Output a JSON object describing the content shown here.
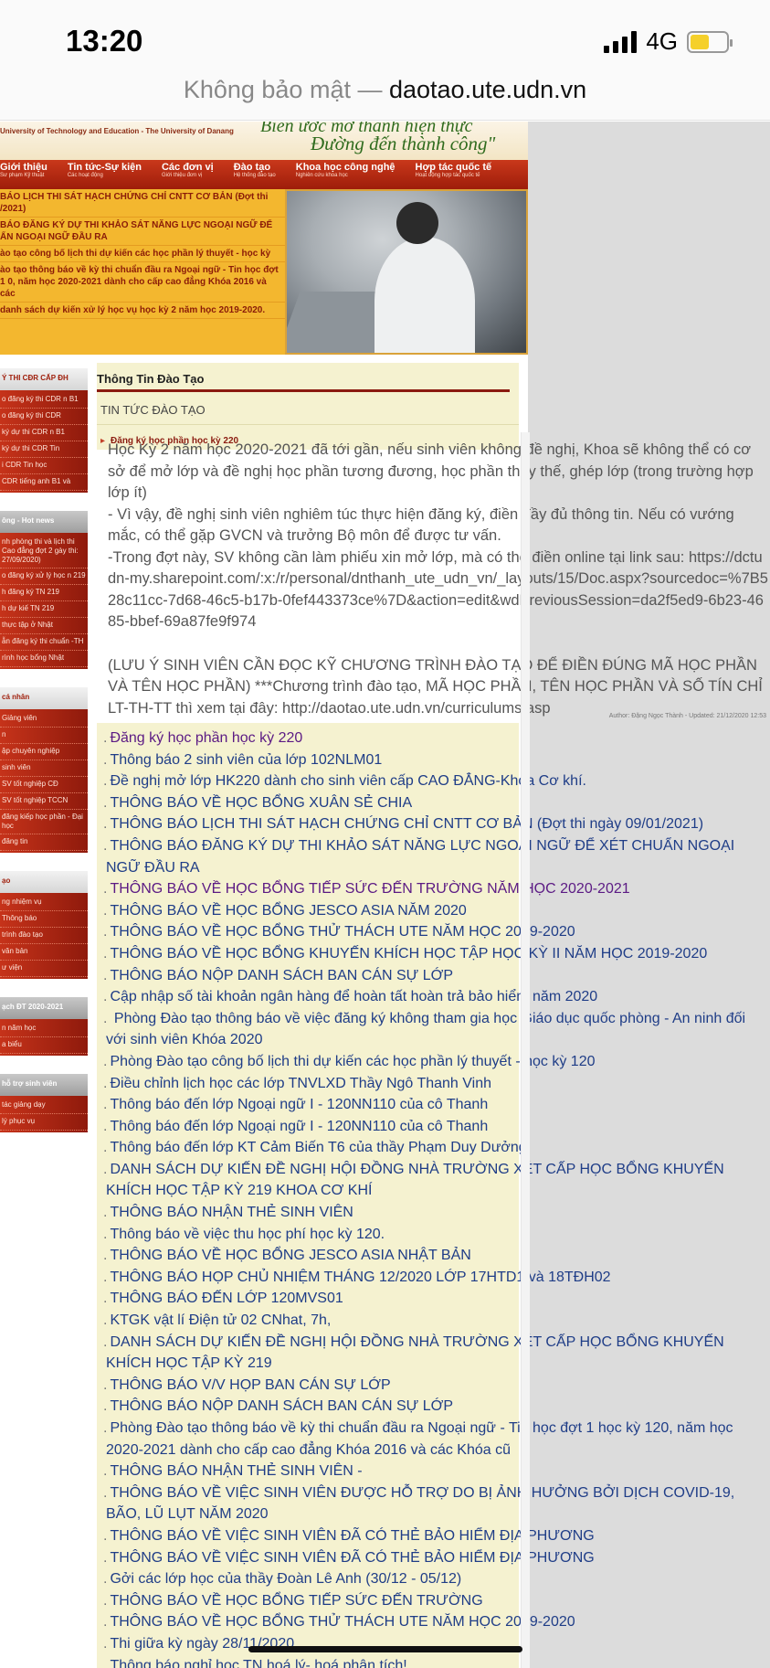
{
  "status_bar": {
    "time": "13:20",
    "network": "4G",
    "battery_level": 0.4,
    "signal_bars": 4
  },
  "url_bar": {
    "insecure_label": "Không bảo mật —",
    "domain": "daotao.ute.udn.vn"
  },
  "banner": {
    "university_name": "University of Technology and Education - The University of Danang",
    "motto_line1": "Biến ước mơ thành hiện thực",
    "motto_line2": "Đường đến thành công\"",
    "nav": [
      {
        "label": "Giới thiệu",
        "sub": "Sư phạm Kỹ thuật"
      },
      {
        "label": "Tin tức-Sự kiện",
        "sub": "Các hoạt động"
      },
      {
        "label": "Các đơn vị",
        "sub": "Giới thiệu đơn vị"
      },
      {
        "label": "Đào tạo",
        "sub": "Hệ thống đào tạo"
      },
      {
        "label": "Khoa học công nghệ",
        "sub": "Nghiên cứu khoa học"
      },
      {
        "label": "Hợp tác quốc tế",
        "sub": "Hoạt động hợp tác quốc tế"
      }
    ],
    "news": [
      "BÁO LỊCH THI SÁT HẠCH CHỨNG CHỈ CNTT CƠ BẢN (Đợt thi /2021)",
      "BÁO ĐĂNG KÝ DỰ THI KHẢO SÁT NĂNG LỰC NGOẠI NGỮ ĐỂ ẨN NGOẠI NGỮ ĐẦU RA",
      "ào tạo công bố lịch thi dự kiến các học phần lý thuyết - học kỳ",
      "ào tạo thông báo về kỳ thi chuẩn đầu ra Ngoại ngữ - Tin học đợt 1 0, năm học 2020-2021 dành cho cấp cao đẳng Khóa 2016 và các",
      "danh sách dự kiến xử lý học vụ học kỳ 2 năm học 2019-2020."
    ]
  },
  "sidebar": {
    "boxes": [
      {
        "title": "Ý THI CĐR CẤP ĐH",
        "dark": false,
        "items": [
          "o đăng ký thi CDR n B1",
          "o đăng ký thi CDR",
          "ký dự thi CDR n B1",
          "ký dự thi CDR Tin",
          "i CDR Tin học",
          "CDR tiếng anh B1 và"
        ]
      },
      {
        "title": "ông - Hot news",
        "dark": true,
        "items": [
          "nh phòng thi và lịch thi Cao đẳng đợt 2 gày thi: 27/09/2020)",
          "o đăng ký xử lý học n 219",
          "h đăng ký TN 219",
          "h dự kiế TN 219",
          "thực tập ở Nhật",
          "ẫn đăng ký thi chuẩn -TH",
          "rình học bổng Nhật"
        ]
      },
      {
        "title": "cá nhân",
        "dark": false,
        "items": [
          "Giảng viên",
          "n",
          "ập chuyên nghiệp",
          "sinh viên",
          "SV tốt nghiệp CĐ",
          "SV tốt nghiệp TCCN",
          "đăng kiếp học phần - Đại học",
          "đăng tin"
        ]
      },
      {
        "title": "ạo",
        "dark": false,
        "items": [
          "ng nhiệm vụ",
          "Thông báo",
          "trình đào tạo",
          "văn bản",
          "ư viện"
        ]
      },
      {
        "title": "ạch ĐT 2020-2021",
        "dark": true,
        "items": [
          "n năm học",
          "a biểu"
        ]
      },
      {
        "title": "hỗ trợ sinh viên",
        "dark": true,
        "items": [
          "tác giảng dạy",
          "lý phục vụ"
        ]
      }
    ]
  },
  "content": {
    "section_title": "Thông Tin Đào Tạo",
    "subhead": "TIN TỨC ĐÀO TẠO",
    "article_title": "Đăng ký học phần học kỳ 220",
    "article_paragraphs": [
      "Học Kỳ 2 năm học 2020-2021 đã tới gần, nếu sinh viên không đề nghị, Khoa sẽ không thể có cơ sở để mở lớp và đề nghị học phần tương đương, học phần thay thế, ghép lớp (trong trường hợp lớp ít)",
      "- Vì vậy, đề nghị sinh viên nghiêm túc thực hiện đăng ký, điền đầy đủ thông tin. Nếu có vướng mắc, có thể gặp GVCN và trưởng Bộ môn để được tư vấn.",
      "-Trong đợt này, SV không cần làm phiếu xin mở lớp, mà có thể điền online tại link sau: https://dctudn-my.sharepoint.com/:x:/r/personal/dnthanh_ute_udn_vn/_layouts/15/Doc.aspx?sourcedoc=%7B528c11cc-7d68-46c5-b17b-0fef443373ce%7D&action=edit&wdPreviousSession=da2f5ed9-6b23-4685-bbef-69a87fe9f974",
      "(LƯU Ý SINH VIÊN CẦN ĐỌC KỸ CHƯƠNG TRÌNH ĐÀO TẠO ĐỂ ĐIỀN ĐÚNG MÃ HỌC PHẦN VÀ TÊN HỌC PHẦN) ***Chương trình đào tạo, MÃ HỌC PHẦN, TÊN HỌC PHẦN VÀ SỐ TÍN CHỈ LT-TH-TT thì xem tại đây: http://daotao.ute.udn.vn/curriculums.asp"
    ],
    "author_line": "Author: Đặng Ngọc Thành - Updated: 21/12/2020 12:53",
    "news_list": [
      {
        "text": "Đăng ký học phần học kỳ 220",
        "visited": true
      },
      {
        "text": "Thông báo 2 sinh viên của lớp 102NLM01",
        "visited": false
      },
      {
        "text": "Đề nghị mở lớp HK220 dành cho sinh viên cấp CAO ĐẲNG-Khoa Cơ khí.",
        "visited": false
      },
      {
        "text": "THÔNG BÁO VỀ HỌC BỔNG XUÂN SẺ CHIA",
        "visited": false
      },
      {
        "text": "THÔNG BÁO LỊCH THI SÁT HẠCH CHỨNG CHỈ CNTT CƠ BẢN (Đợt thi ngày 09/01/2021)",
        "visited": false
      },
      {
        "text": "THÔNG BÁO ĐĂNG KÝ DỰ THI KHẢO SÁT NĂNG LỰC NGOẠI NGỮ ĐỂ XÉT CHUẨN NGOẠI NGỮ ĐẦU RA",
        "visited": false
      },
      {
        "text": "THÔNG BÁO VỀ HỌC BỔNG TIẾP SỨC ĐẾN TRƯỜNG NĂM HỌC 2020-2021",
        "visited": true
      },
      {
        "text": "THÔNG BÁO VỀ HỌC BỔNG JESCO ASIA NĂM 2020",
        "visited": false
      },
      {
        "text": "THÔNG BÁO VỀ HỌC BỔNG THỬ THÁCH UTE NĂM HỌC 2019-2020",
        "visited": false
      },
      {
        "text": "THÔNG BÁO VỀ HỌC BỔNG KHUYẾN KHÍCH HỌC TẬP HỌC KỲ II NĂM HỌC 2019-2020",
        "visited": false
      },
      {
        "text": "THÔNG BÁO NỘP DANH SÁCH BAN CÁN SỰ LỚP",
        "visited": false
      },
      {
        "text": "Cập nhập số tài khoản ngân hàng để hoàn tất hoàn trả bảo hiểm năm 2020",
        "visited": false
      },
      {
        "text": " Phòng Đào tạo thông báo về việc đăng ký không tham gia học Giáo dục quốc phòng - An ninh đối với sinh viên Khóa 2020",
        "visited": false
      },
      {
        "text": "Phòng Đào tạo công bố lịch thi dự kiến các học phần lý thuyết - học kỳ 120",
        "visited": false
      },
      {
        "text": "Điều chỉnh lịch học các lớp TNVLXD Thầy Ngô Thanh Vinh",
        "visited": false
      },
      {
        "text": "Thông báo đến lớp Ngoại ngữ I - 120NN110 của cô Thanh",
        "visited": false
      },
      {
        "text": "Thông báo đến lớp Ngoại ngữ I - 120NN110 của cô Thanh",
        "visited": false
      },
      {
        "text": "Thông báo đến lớp KT Cảm Biến T6 của thầy Phạm Duy Dưởng",
        "visited": false
      },
      {
        "text": "DANH SÁCH DỰ KIẾN ĐỀ NGHỊ HỘI ĐỒNG NHÀ TRƯỜNG XÉT CẤP HỌC BỔNG KHUYẾN KHÍCH HỌC TẬP KỲ 219 KHOA CƠ KHÍ",
        "visited": false
      },
      {
        "text": "THÔNG BÁO NHẬN THẺ SINH VIÊN",
        "visited": false
      },
      {
        "text": "Thông báo về việc thu học phí học kỳ 120.",
        "visited": false
      },
      {
        "text": "THÔNG BÁO VỀ HỌC BỔNG JESCO ASIA NHẬT BẢN",
        "visited": false
      },
      {
        "text": "THÔNG BÁO HỌP CHỦ NHIỆM THÁNG 12/2020 LỚP 17HTD1 và 18TĐH02",
        "visited": false
      },
      {
        "text": "THÔNG BÁO ĐẾN LỚP 120MVS01",
        "visited": false
      },
      {
        "text": "KTGK vật lí Điện tử 02 CNhat, 7h,",
        "visited": false
      },
      {
        "text": "DANH SÁCH DỰ KIẾN ĐỀ NGHỊ HỘI ĐỒNG NHÀ TRƯỜNG XÉT CẤP HỌC BỔNG KHUYẾN KHÍCH HỌC TẬP KỲ 219",
        "visited": false
      },
      {
        "text": "THÔNG BÁO V/V HỌP BAN CÁN SỰ LỚP",
        "visited": false
      },
      {
        "text": "THÔNG BÁO NỘP DANH SÁCH BAN CÁN SỰ LỚP",
        "visited": false
      },
      {
        "text": "Phòng Đào tạo thông báo về kỳ thi chuẩn đầu ra Ngoại ngữ - Tin học đợt 1 học kỳ 120, năm học 2020-2021 dành cho cấp cao đẳng Khóa 2016 và các Khóa cũ",
        "visited": false
      },
      {
        "text": "THÔNG BÁO NHẬN THẺ SINH VIÊN -",
        "visited": false
      },
      {
        "text": "THÔNG BÁO VỀ VIỆC SINH VIÊN ĐƯỢC HỖ TRỢ DO BỊ ẢNH HƯỞNG BỞI DỊCH COVID-19, BÃO, LŨ LỤT NĂM 2020",
        "visited": false
      },
      {
        "text": "THÔNG BÁO VỀ VIỆC SINH VIÊN ĐÃ CÓ THẺ BẢO HIỂM ĐỊA PHƯƠNG",
        "visited": false
      },
      {
        "text": "THÔNG BÁO VỀ VIỆC SINH VIÊN ĐÃ CÓ THẺ BẢO HIỂM ĐỊA PHƯƠNG",
        "visited": false
      },
      {
        "text": "Gởi các lớp học của thầy Đoàn Lê Anh (30/12 - 05/12)",
        "visited": false
      },
      {
        "text": "THÔNG BÁO VỀ HỌC BỔNG TIẾP SỨC ĐẾN TRƯỜNG",
        "visited": false
      },
      {
        "text": "THÔNG BÁO VỀ HỌC BỔNG THỬ THÁCH UTE NĂM HỌC 2019-2020",
        "visited": false
      },
      {
        "text": "Thi giữa kỳ ngày 28/11/2020",
        "visited": false
      },
      {
        "text": "Thông báo nghỉ học TN hoá lý- hoá phân tích!",
        "visited": false
      }
    ]
  },
  "colors": {
    "link": "#1f3d87",
    "visited_link": "#5b1a84",
    "panel_bg": "#f5f2d0",
    "brand_red": "#9e1d0a",
    "banner_gold": "#f4c24a"
  }
}
